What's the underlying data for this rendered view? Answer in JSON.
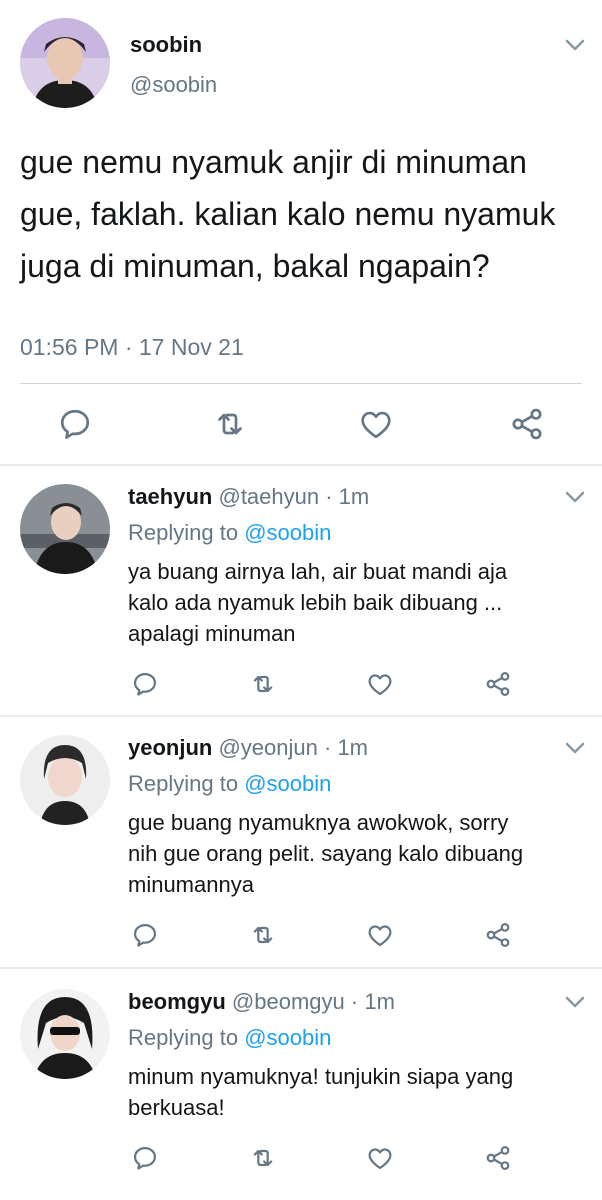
{
  "main_tweet": {
    "name": "soobin",
    "handle": "@soobin",
    "text": "gue nemu nyamuk anjir di minuman gue, faklah. kalian kalo nemu nyamuk juga di minuman, bakal ngapain?",
    "timestamp": "01:56 PM · 17 Nov 21",
    "menu_icon": "chevron-down-icon",
    "actions": [
      "reply-icon",
      "retweet-icon",
      "like-icon",
      "share-icon"
    ]
  },
  "replies": [
    {
      "name": "taehyun",
      "handle": "@taehyun",
      "time": "· 1m",
      "replying_prefix": "Replying to ",
      "replying_to": "@soobin",
      "text_lines": [
        "ya buang airnya lah, air buat mandi aja",
        "kalo ada nyamuk lebih baik dibuang ...",
        "apalagi minuman"
      ]
    },
    {
      "name": "yeonjun",
      "handle": "@yeonjun",
      "time": "· 1m",
      "replying_prefix": "Replying to ",
      "replying_to": "@soobin",
      "text_lines": [
        "gue buang nyamuknya awokwok, sorry",
        "nih gue orang pelit. sayang kalo dibuang",
        "minumannya"
      ]
    },
    {
      "name": "beomgyu",
      "handle": "@beomgyu",
      "time": "· 1m",
      "replying_prefix": "Replying to ",
      "replying_to": "@soobin",
      "text_lines": [
        "minum nyamuknya! tunjukin siapa yang",
        "berkuasa!"
      ]
    }
  ],
  "colors": {
    "text": "#14171a",
    "secondary": "#657786",
    "link": "#1da1f2",
    "divider": "#e6ecf0"
  }
}
